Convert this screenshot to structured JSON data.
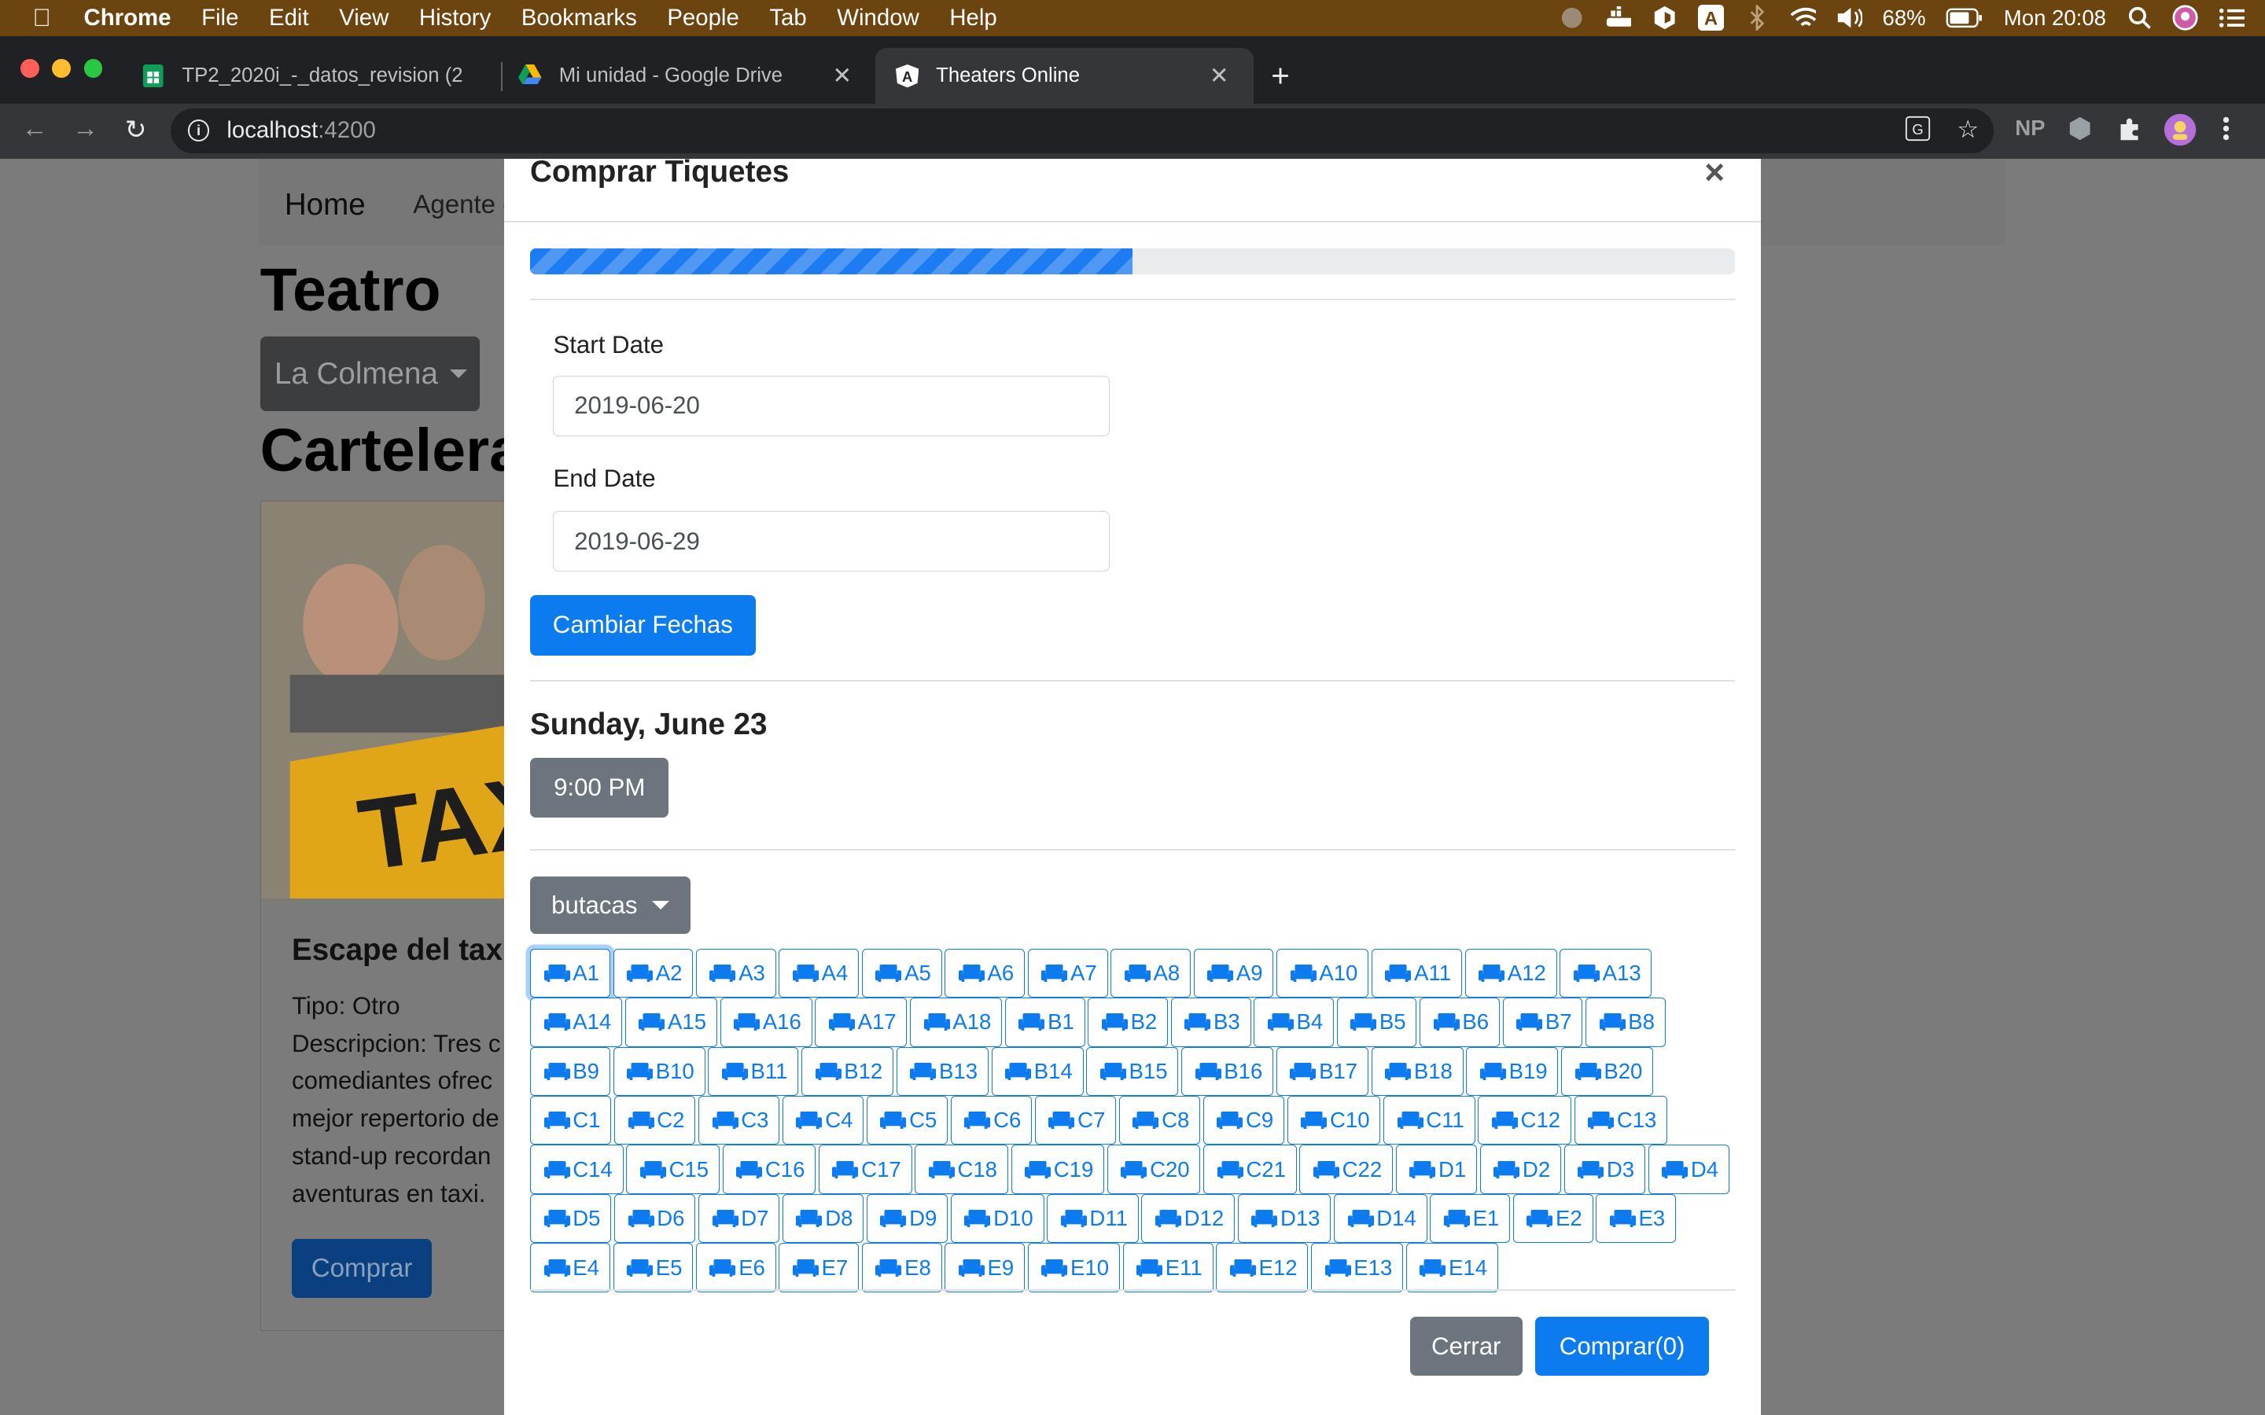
{
  "menubar": {
    "app": "Chrome",
    "items": [
      "File",
      "Edit",
      "View",
      "History",
      "Bookmarks",
      "People",
      "Tab",
      "Window",
      "Help"
    ],
    "battery": "68%",
    "clock": "Mon 20:08"
  },
  "tabs": [
    {
      "title": "TP2_2020i_-_datos_revision (2",
      "icon": "sheets-icon"
    },
    {
      "title": "Mi unidad - Google Drive",
      "icon": "drive-icon"
    },
    {
      "title": "Theaters Online",
      "icon": "angular-icon"
    }
  ],
  "omnibox": {
    "host": "localhost",
    "port": ":4200"
  },
  "extensions": {
    "np": "NP"
  },
  "page": {
    "nav": {
      "home": "Home",
      "agent": "Agente d"
    },
    "heading": "Teatro",
    "theater_select": "La Colmena",
    "section": "Cartelera",
    "card": {
      "title": "Escape del taxi",
      "tipo": "Tipo: Otro",
      "desc_lines": [
        "Descripcion: Tres c",
        "comediantes ofrec",
        "mejor repertorio de",
        "stand-up recordan",
        "aventuras en taxi."
      ],
      "button": "Comprar",
      "image_text": "TAX"
    }
  },
  "modal": {
    "title": "Comprar Tiquetes",
    "close": "×",
    "progress": 0.5,
    "start_label": "Start Date",
    "start_value": "2019-06-20",
    "end_label": "End Date",
    "end_value": "2019-06-29",
    "change_dates": "Cambiar Fechas",
    "day": "Sunday, June 23",
    "time": "9:00 PM",
    "seats_dropdown": "butacas",
    "seats": [
      "A1",
      "A2",
      "A3",
      "A4",
      "A5",
      "A6",
      "A7",
      "A8",
      "A9",
      "A10",
      "A11",
      "A12",
      "A13",
      "A14",
      "A15",
      "A16",
      "A17",
      "A18",
      "B1",
      "B2",
      "B3",
      "B4",
      "B5",
      "B6",
      "B7",
      "B8",
      "B9",
      "B10",
      "B11",
      "B12",
      "B13",
      "B14",
      "B15",
      "B16",
      "B17",
      "B18",
      "B19",
      "B20",
      "C1",
      "C2",
      "C3",
      "C4",
      "C5",
      "C6",
      "C7",
      "C8",
      "C9",
      "C10",
      "C11",
      "C12",
      "C13",
      "C14",
      "C15",
      "C16",
      "C17",
      "C18",
      "C19",
      "C20",
      "C21",
      "C22",
      "D1",
      "D2",
      "D3",
      "D4",
      "D5",
      "D6",
      "D7",
      "D8",
      "D9",
      "D10",
      "D11",
      "D12",
      "D13",
      "D14",
      "E1",
      "E2",
      "E3",
      "E4",
      "E5",
      "E6",
      "E7",
      "E8",
      "E9",
      "E10",
      "E11",
      "E12",
      "E13",
      "E14"
    ],
    "selected_seat": "A1",
    "close_button": "Cerrar",
    "buy_button": "Comprar(0)"
  },
  "colors": {
    "primary": "#0d7bf0",
    "secondary": "#6c757d",
    "menubar": "#6b4410"
  }
}
